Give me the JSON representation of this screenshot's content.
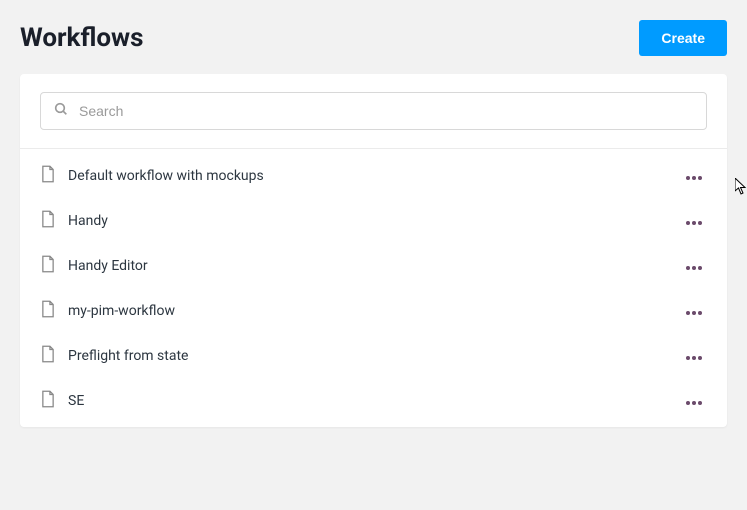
{
  "header": {
    "title": "Workflows",
    "create_label": "Create"
  },
  "search": {
    "placeholder": "Search",
    "value": ""
  },
  "workflows": [
    {
      "name": "Default workflow with mockups"
    },
    {
      "name": "Handy"
    },
    {
      "name": "Handy Editor"
    },
    {
      "name": "my-pim-workflow"
    },
    {
      "name": "Preflight from state"
    },
    {
      "name": "SE"
    }
  ]
}
